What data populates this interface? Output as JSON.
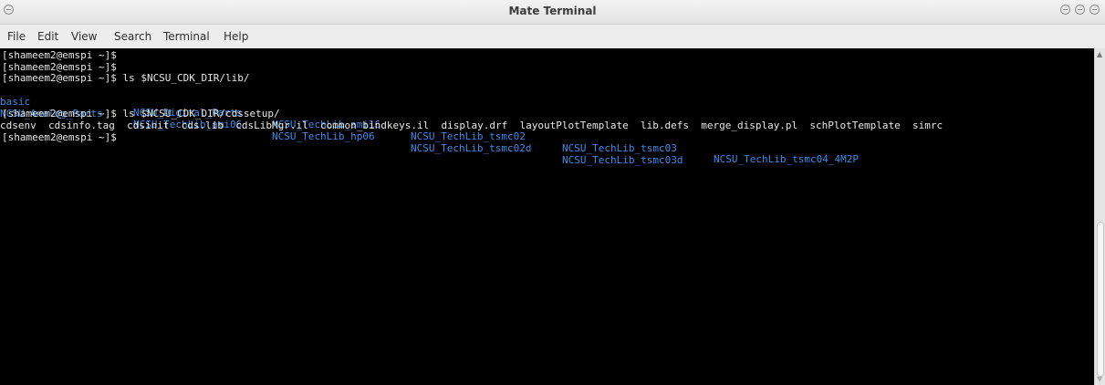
{
  "window": {
    "title": "Mate Terminal"
  },
  "menu": {
    "items": [
      "File",
      "Edit",
      "View",
      "Search",
      "Terminal",
      "Help"
    ]
  },
  "terminal": {
    "prompt": "[shameem2@emspi ~]$",
    "lines": [
      "[shameem2@emspi ~]$",
      "[shameem2@emspi ~]$",
      "[shameem2@emspi ~]$ ls $NCSU_CDK_DIR/lib/"
    ],
    "lib_listing": {
      "row1": [
        "basic",
        "NCSU_Digital_Parts",
        "NCSU_TechLib_ami16",
        "NCSU_TechLib_tsmc02",
        "NCSU_TechLib_tsmc03",
        "NCSU_TechLib_tsmc04_4M2P"
      ],
      "row2": [
        "NCSU_Analog_Parts",
        "NCSU_TechLib_ami06",
        "NCSU_TechLib_hp06",
        "NCSU_TechLib_tsmc02d",
        "NCSU_TechLib_tsmc03d"
      ]
    },
    "cmd2": "[shameem2@emspi ~]$ ls $NCSU_CDK_DIR/cdssetup/",
    "cdssetup_listing": "cdsenv  cdsinfo.tag  cdsinit  cds.lib  cdsLibMgr.il  common_bindkeys.il  display.drf  layoutPlotTemplate  lib.defs  merge_display.pl  schPlotTemplate  simrc",
    "final_prompt": "[shameem2@emspi ~]$"
  },
  "colors": {
    "directory": "#3d8ce6",
    "text": "#e8e8e8",
    "background": "#000000"
  },
  "icons": {
    "window_menu": "window-menu-icon",
    "minimize": "minimize-icon",
    "maximize": "maximize-icon",
    "close": "close-icon"
  }
}
